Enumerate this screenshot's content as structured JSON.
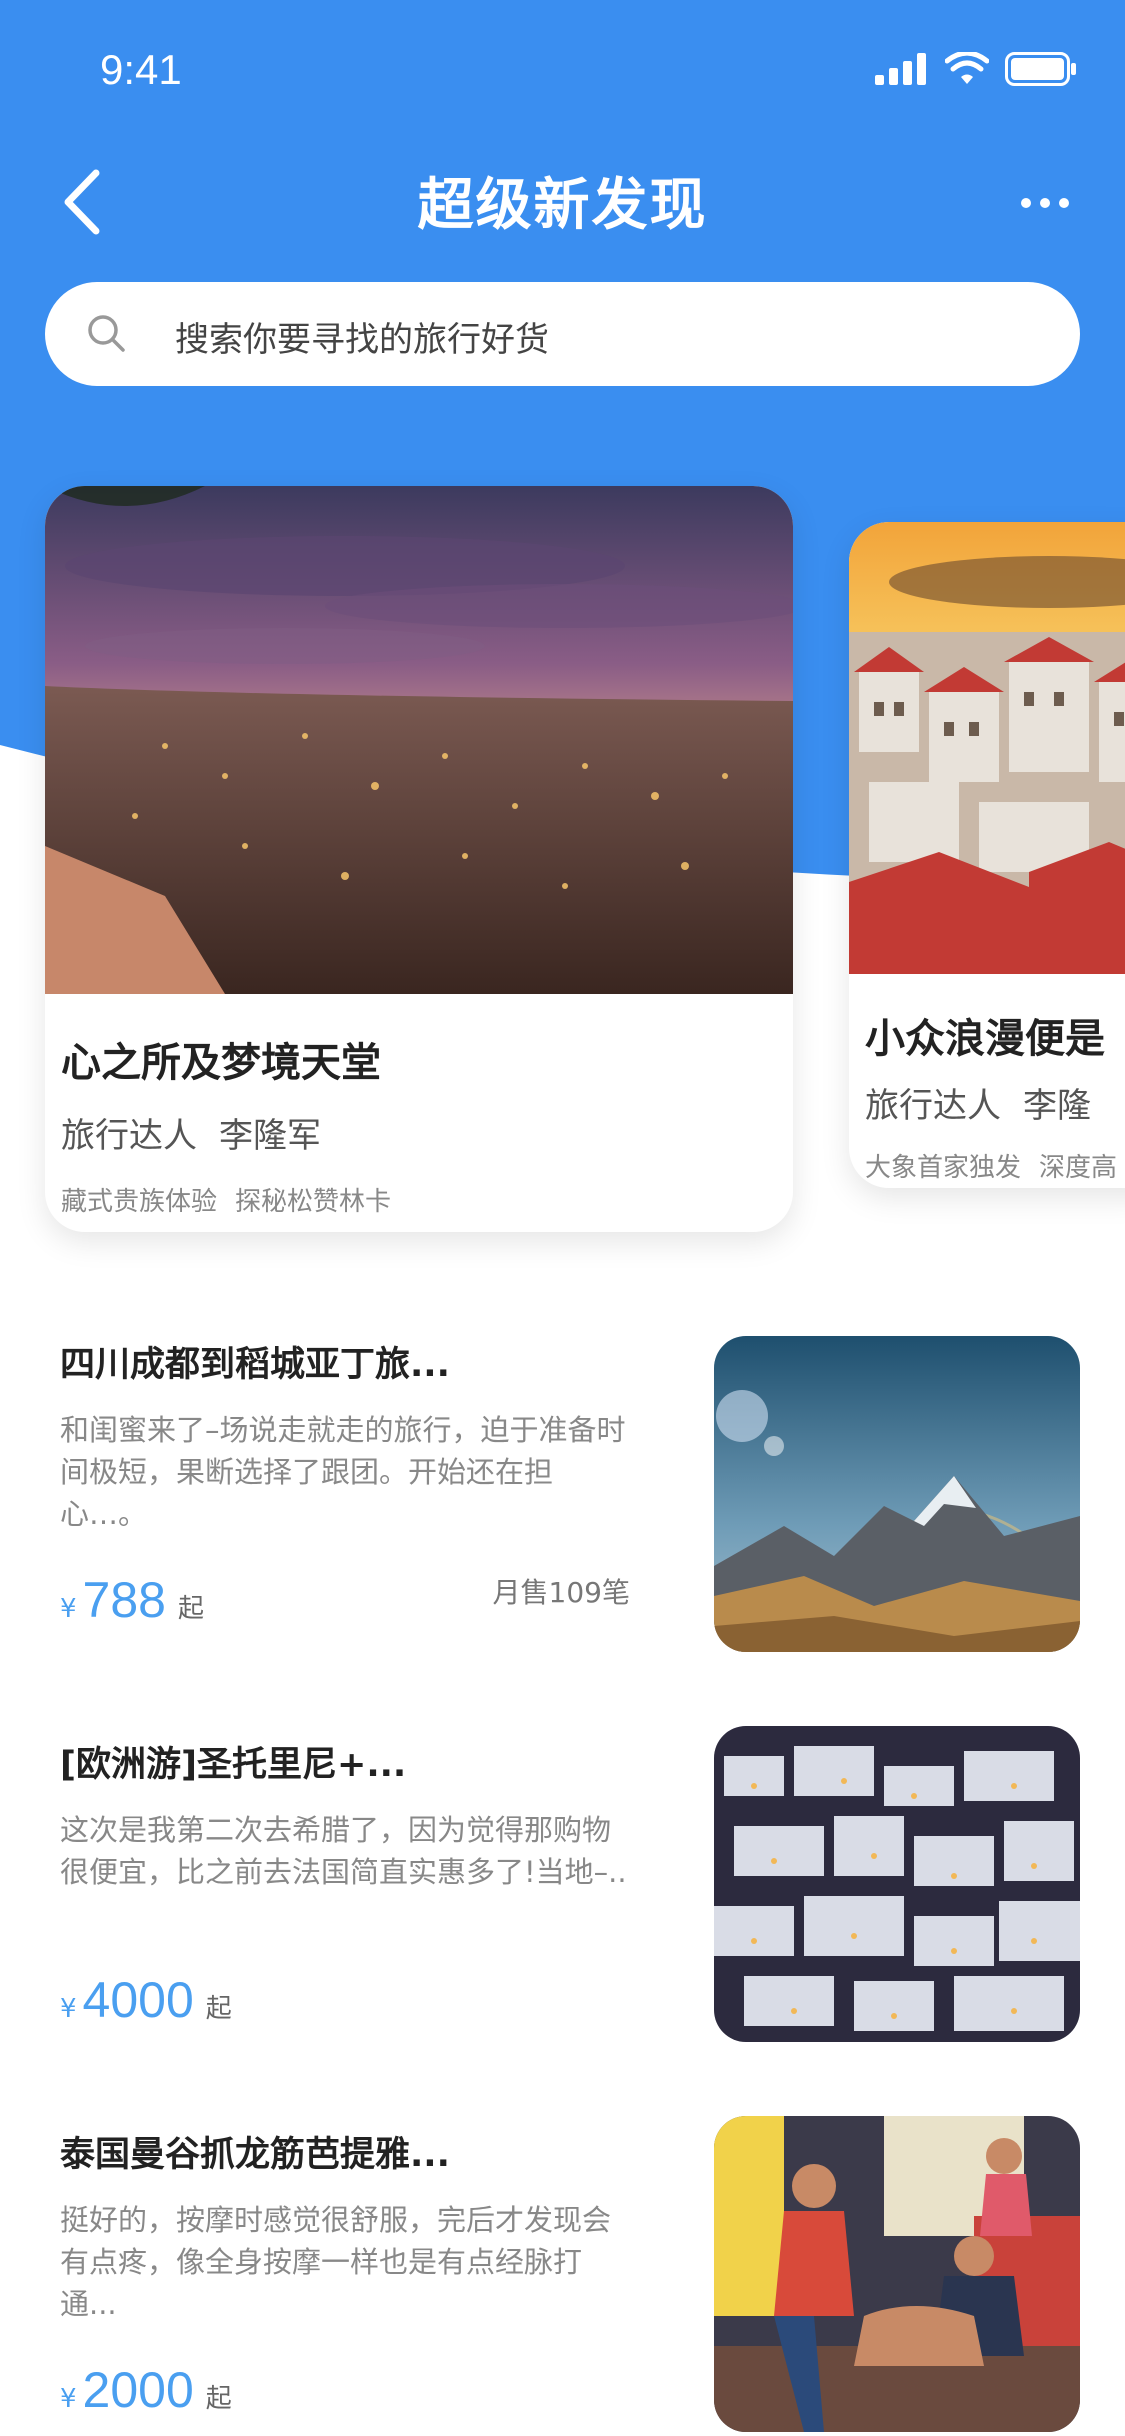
{
  "status": {
    "time": "9:41"
  },
  "nav": {
    "title": "超级新发现"
  },
  "search": {
    "placeholder": "搜索你要寻找的旅行好货"
  },
  "featured": [
    {
      "title": "心之所及梦境天堂",
      "author_role": "旅行达人",
      "author_name": "李隆军",
      "tags": [
        "藏式贵族体验",
        "探秘松赞林卡"
      ]
    },
    {
      "title": "小众浪漫便是",
      "author_role": "旅行达人",
      "author_name": "李隆",
      "tags": [
        "大象首家独发",
        "深度高"
      ]
    }
  ],
  "list": [
    {
      "title": "四川成都到稻城亚丁旅...",
      "desc": "和闺蜜来了–场说走就走的旅行，迫于准备时间极短，果断选择了跟团。开始还在担心…。",
      "currency": "¥",
      "price": "788",
      "suffix": "起",
      "sold": "月售109笔"
    },
    {
      "title": "[欧洲游]圣托里尼+...",
      "desc": "这次是我第二次去希腊了，因为觉得那购物很便宜，比之前去法国简直实惠多了!当地–..",
      "currency": "¥",
      "price": "4000",
      "suffix": "起"
    },
    {
      "title": "泰国曼谷抓龙筋芭提雅...",
      "desc": "挺好的，按摩时感觉很舒服，完后才发现会有点疼，像全身按摩一样也是有点经脉打通...",
      "currency": "¥",
      "price": "2000",
      "suffix": "起"
    }
  ],
  "colors": {
    "brand_blue": "#3a8ef0",
    "price_blue": "#4a9ff0"
  }
}
